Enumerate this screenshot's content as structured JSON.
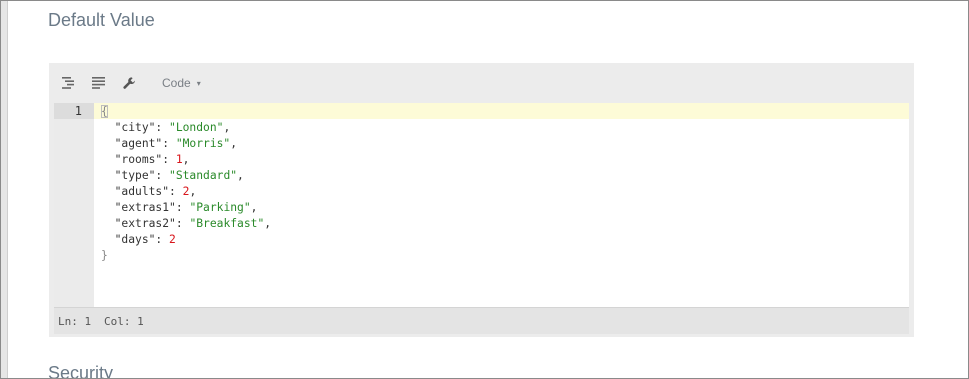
{
  "section_title": "Default Value",
  "next_section_title": "Security",
  "toolbar": {
    "format_icon": "format-indent-icon",
    "compact_icon": "compact-lines-icon",
    "repair_icon": "wrench-icon",
    "mode_label": "Code",
    "mode_caret": "▾"
  },
  "editor": {
    "line_number": "1",
    "open_brace": "{",
    "close_brace": "}",
    "entries": [
      {
        "key": "\"city\"",
        "value": "\"London\"",
        "type": "string",
        "comma": ","
      },
      {
        "key": "\"agent\"",
        "value": "\"Morris\"",
        "type": "string",
        "comma": ","
      },
      {
        "key": "\"rooms\"",
        "value": "1",
        "type": "number",
        "comma": ","
      },
      {
        "key": "\"type\"",
        "value": "\"Standard\"",
        "type": "string",
        "comma": ","
      },
      {
        "key": "\"adults\"",
        "value": "2",
        "type": "number",
        "comma": ","
      },
      {
        "key": "\"extras1\"",
        "value": "\"Parking\"",
        "type": "string",
        "comma": ","
      },
      {
        "key": "\"extras2\"",
        "value": "\"Breakfast\"",
        "type": "string",
        "comma": ","
      },
      {
        "key": "\"days\"",
        "value": "2",
        "type": "number",
        "comma": ""
      }
    ]
  },
  "status": {
    "ln": "Ln: 1",
    "col": "Col: 1"
  }
}
